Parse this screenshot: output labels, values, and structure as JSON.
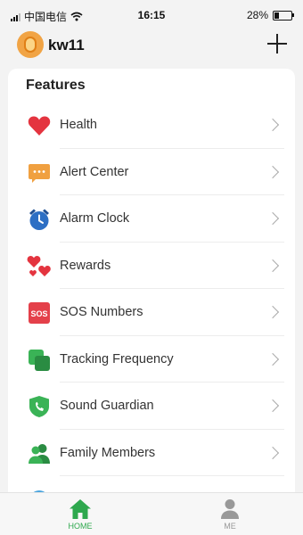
{
  "status_bar": {
    "carrier": "中国电信",
    "time": "16:15",
    "battery_percent": "28%",
    "battery_level": 0.28
  },
  "header": {
    "device_name": "kw11"
  },
  "features": {
    "title": "Features",
    "items": [
      {
        "label": "Health",
        "icon": "heart-icon"
      },
      {
        "label": "Alert Center",
        "icon": "message-icon"
      },
      {
        "label": "Alarm Clock",
        "icon": "alarm-clock-icon"
      },
      {
        "label": "Rewards",
        "icon": "hearts-icon"
      },
      {
        "label": "SOS Numbers",
        "icon": "sos-icon",
        "icon_text": "SOS"
      },
      {
        "label": "Tracking Frequency",
        "icon": "tracking-icon"
      },
      {
        "label": "Sound Guardian",
        "icon": "phone-shield-icon"
      },
      {
        "label": "Family Members",
        "icon": "family-icon"
      }
    ]
  },
  "bottom_nav": {
    "tabs": [
      {
        "label": "HOME",
        "icon": "home-icon",
        "active": true
      },
      {
        "label": "ME",
        "icon": "person-icon",
        "active": false
      }
    ]
  },
  "colors": {
    "accent": "#2ea84e",
    "heart": "#e4343f",
    "alert": "#f0a040",
    "alarm": "#2d6fc4",
    "sos": "#e4404a",
    "green_icon": "#3ab356",
    "avatar": "#f1a445"
  }
}
